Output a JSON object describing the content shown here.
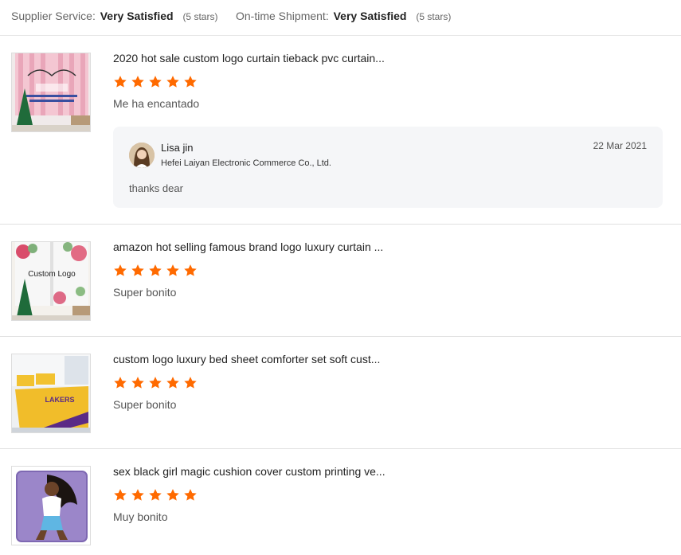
{
  "ratings_summary": {
    "supplier_service": {
      "label": "Supplier Service:",
      "value": "Very Satisfied",
      "stars": "(5 stars)"
    },
    "on_time_shipment": {
      "label": "On-time Shipment:",
      "value": "Very Satisfied",
      "stars": "(5 stars)"
    }
  },
  "colors": {
    "star": "#ff6a00",
    "reply_bg": "#f5f6f8",
    "divider": "#e0e0e0"
  },
  "reviews": [
    {
      "product_title": "2020 hot sale custom logo curtain tieback pvc curtain...",
      "rating": 5,
      "comment": "Me ha encantado",
      "thumbnail_icon": "pink-curtain-thumbnail",
      "reply": {
        "name": "Lisa jin",
        "company": "Hefei Laiyan Electronic Commerce Co., Ltd.",
        "date": "22 Mar 2021",
        "text": "thanks dear"
      }
    },
    {
      "product_title": "amazon hot selling famous brand logo luxury curtain ...",
      "rating": 5,
      "comment": "Super bonito",
      "thumbnail_icon": "floral-curtain-thumbnail",
      "thumbnail_text": "Custom Logo"
    },
    {
      "product_title": "custom logo luxury bed sheet comforter set soft cust...",
      "rating": 5,
      "comment": "Super bonito",
      "thumbnail_icon": "bedding-set-thumbnail",
      "thumbnail_text": "LAKERS"
    },
    {
      "product_title": "sex black girl magic cushion cover custom printing ve...",
      "rating": 5,
      "comment": "Muy bonito",
      "thumbnail_icon": "cushion-cover-thumbnail"
    }
  ]
}
